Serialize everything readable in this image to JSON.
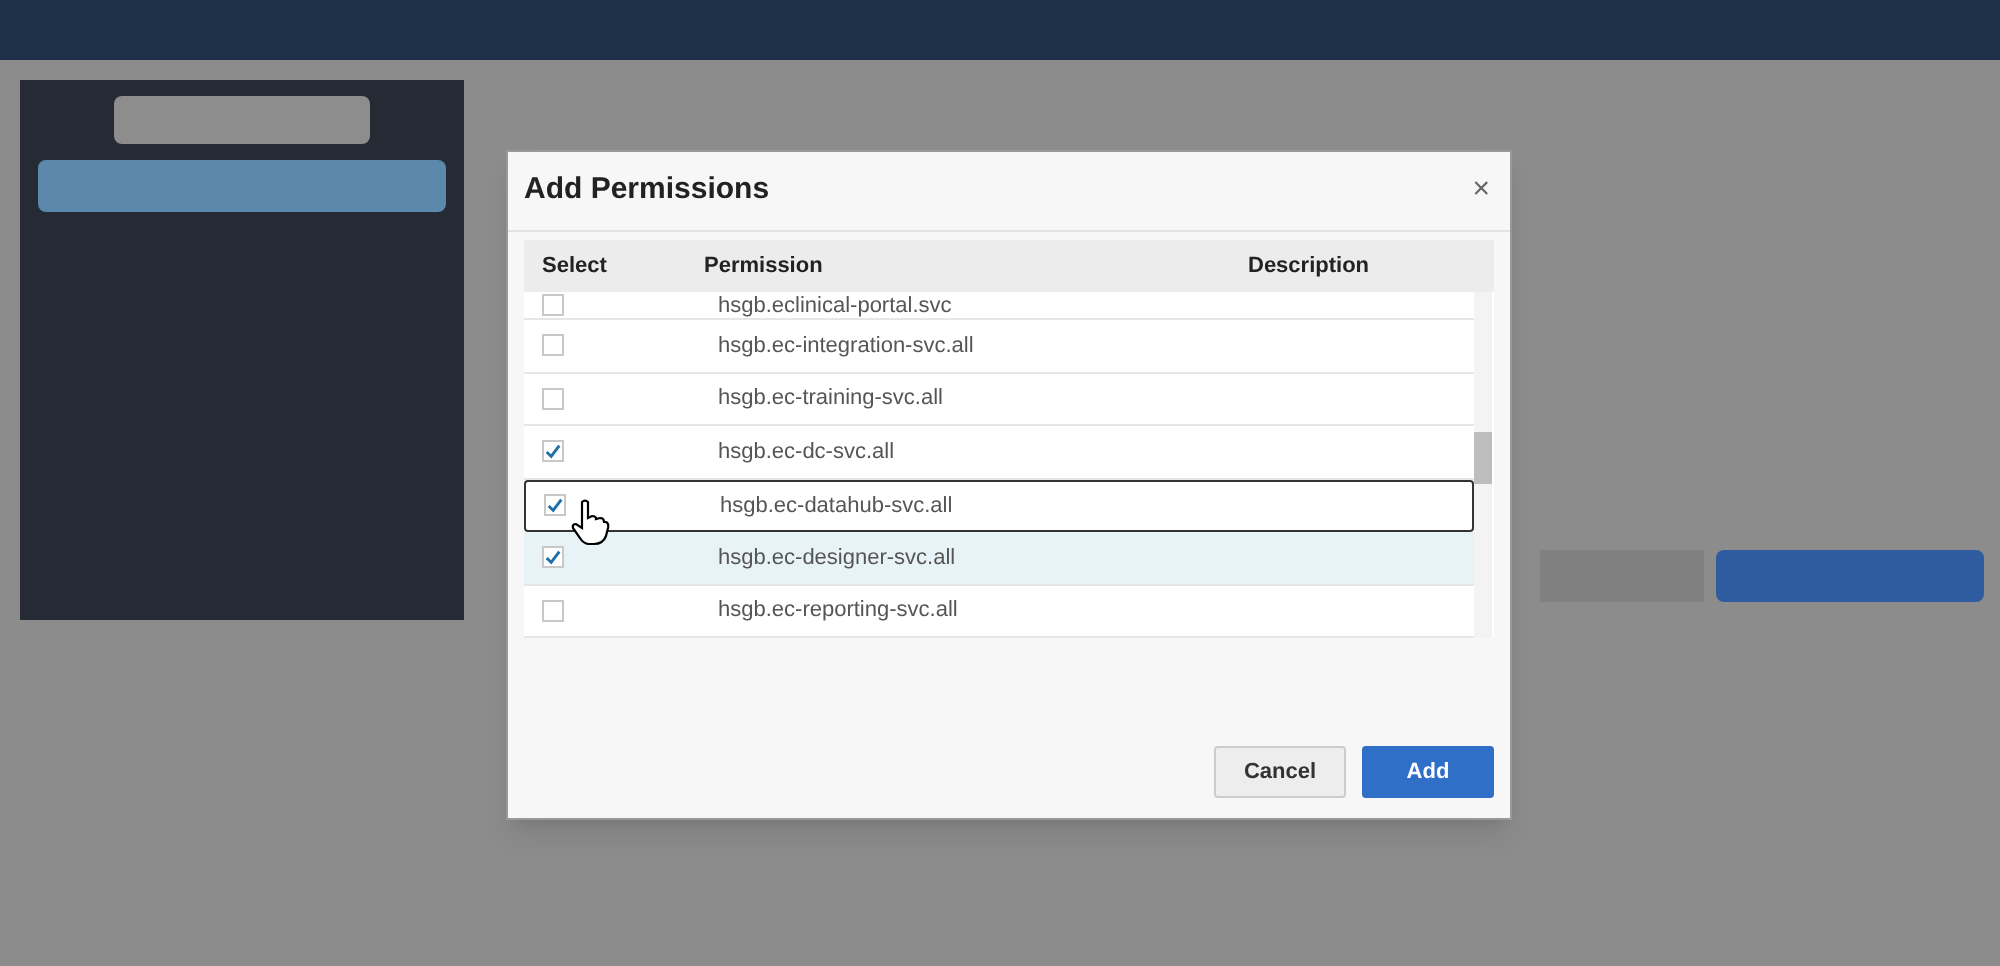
{
  "dialog": {
    "title": "Add Permissions",
    "close": "×"
  },
  "table": {
    "columns": [
      "Select",
      "Permission",
      "Description"
    ],
    "rows": [
      {
        "permission": "hsgb.eclinical-portal.svc",
        "checked": false,
        "focused": false,
        "highlighted": false
      },
      {
        "permission": "hsgb.ec-integration-svc.all",
        "checked": false,
        "focused": false,
        "highlighted": false
      },
      {
        "permission": "hsgb.ec-training-svc.all",
        "checked": false,
        "focused": false,
        "highlighted": false
      },
      {
        "permission": "hsgb.ec-dc-svc.all",
        "checked": true,
        "focused": false,
        "highlighted": false
      },
      {
        "permission": "hsgb.ec-datahub-svc.all",
        "checked": true,
        "focused": true,
        "highlighted": false
      },
      {
        "permission": "hsgb.ec-designer-svc.all",
        "checked": true,
        "focused": false,
        "highlighted": true
      },
      {
        "permission": "hsgb.ec-reporting-svc.all",
        "checked": false,
        "focused": false,
        "highlighted": false
      }
    ]
  },
  "buttons": [
    {
      "label": "Cancel",
      "kind": "secondary"
    },
    {
      "label": "Add",
      "kind": "primary"
    }
  ]
}
